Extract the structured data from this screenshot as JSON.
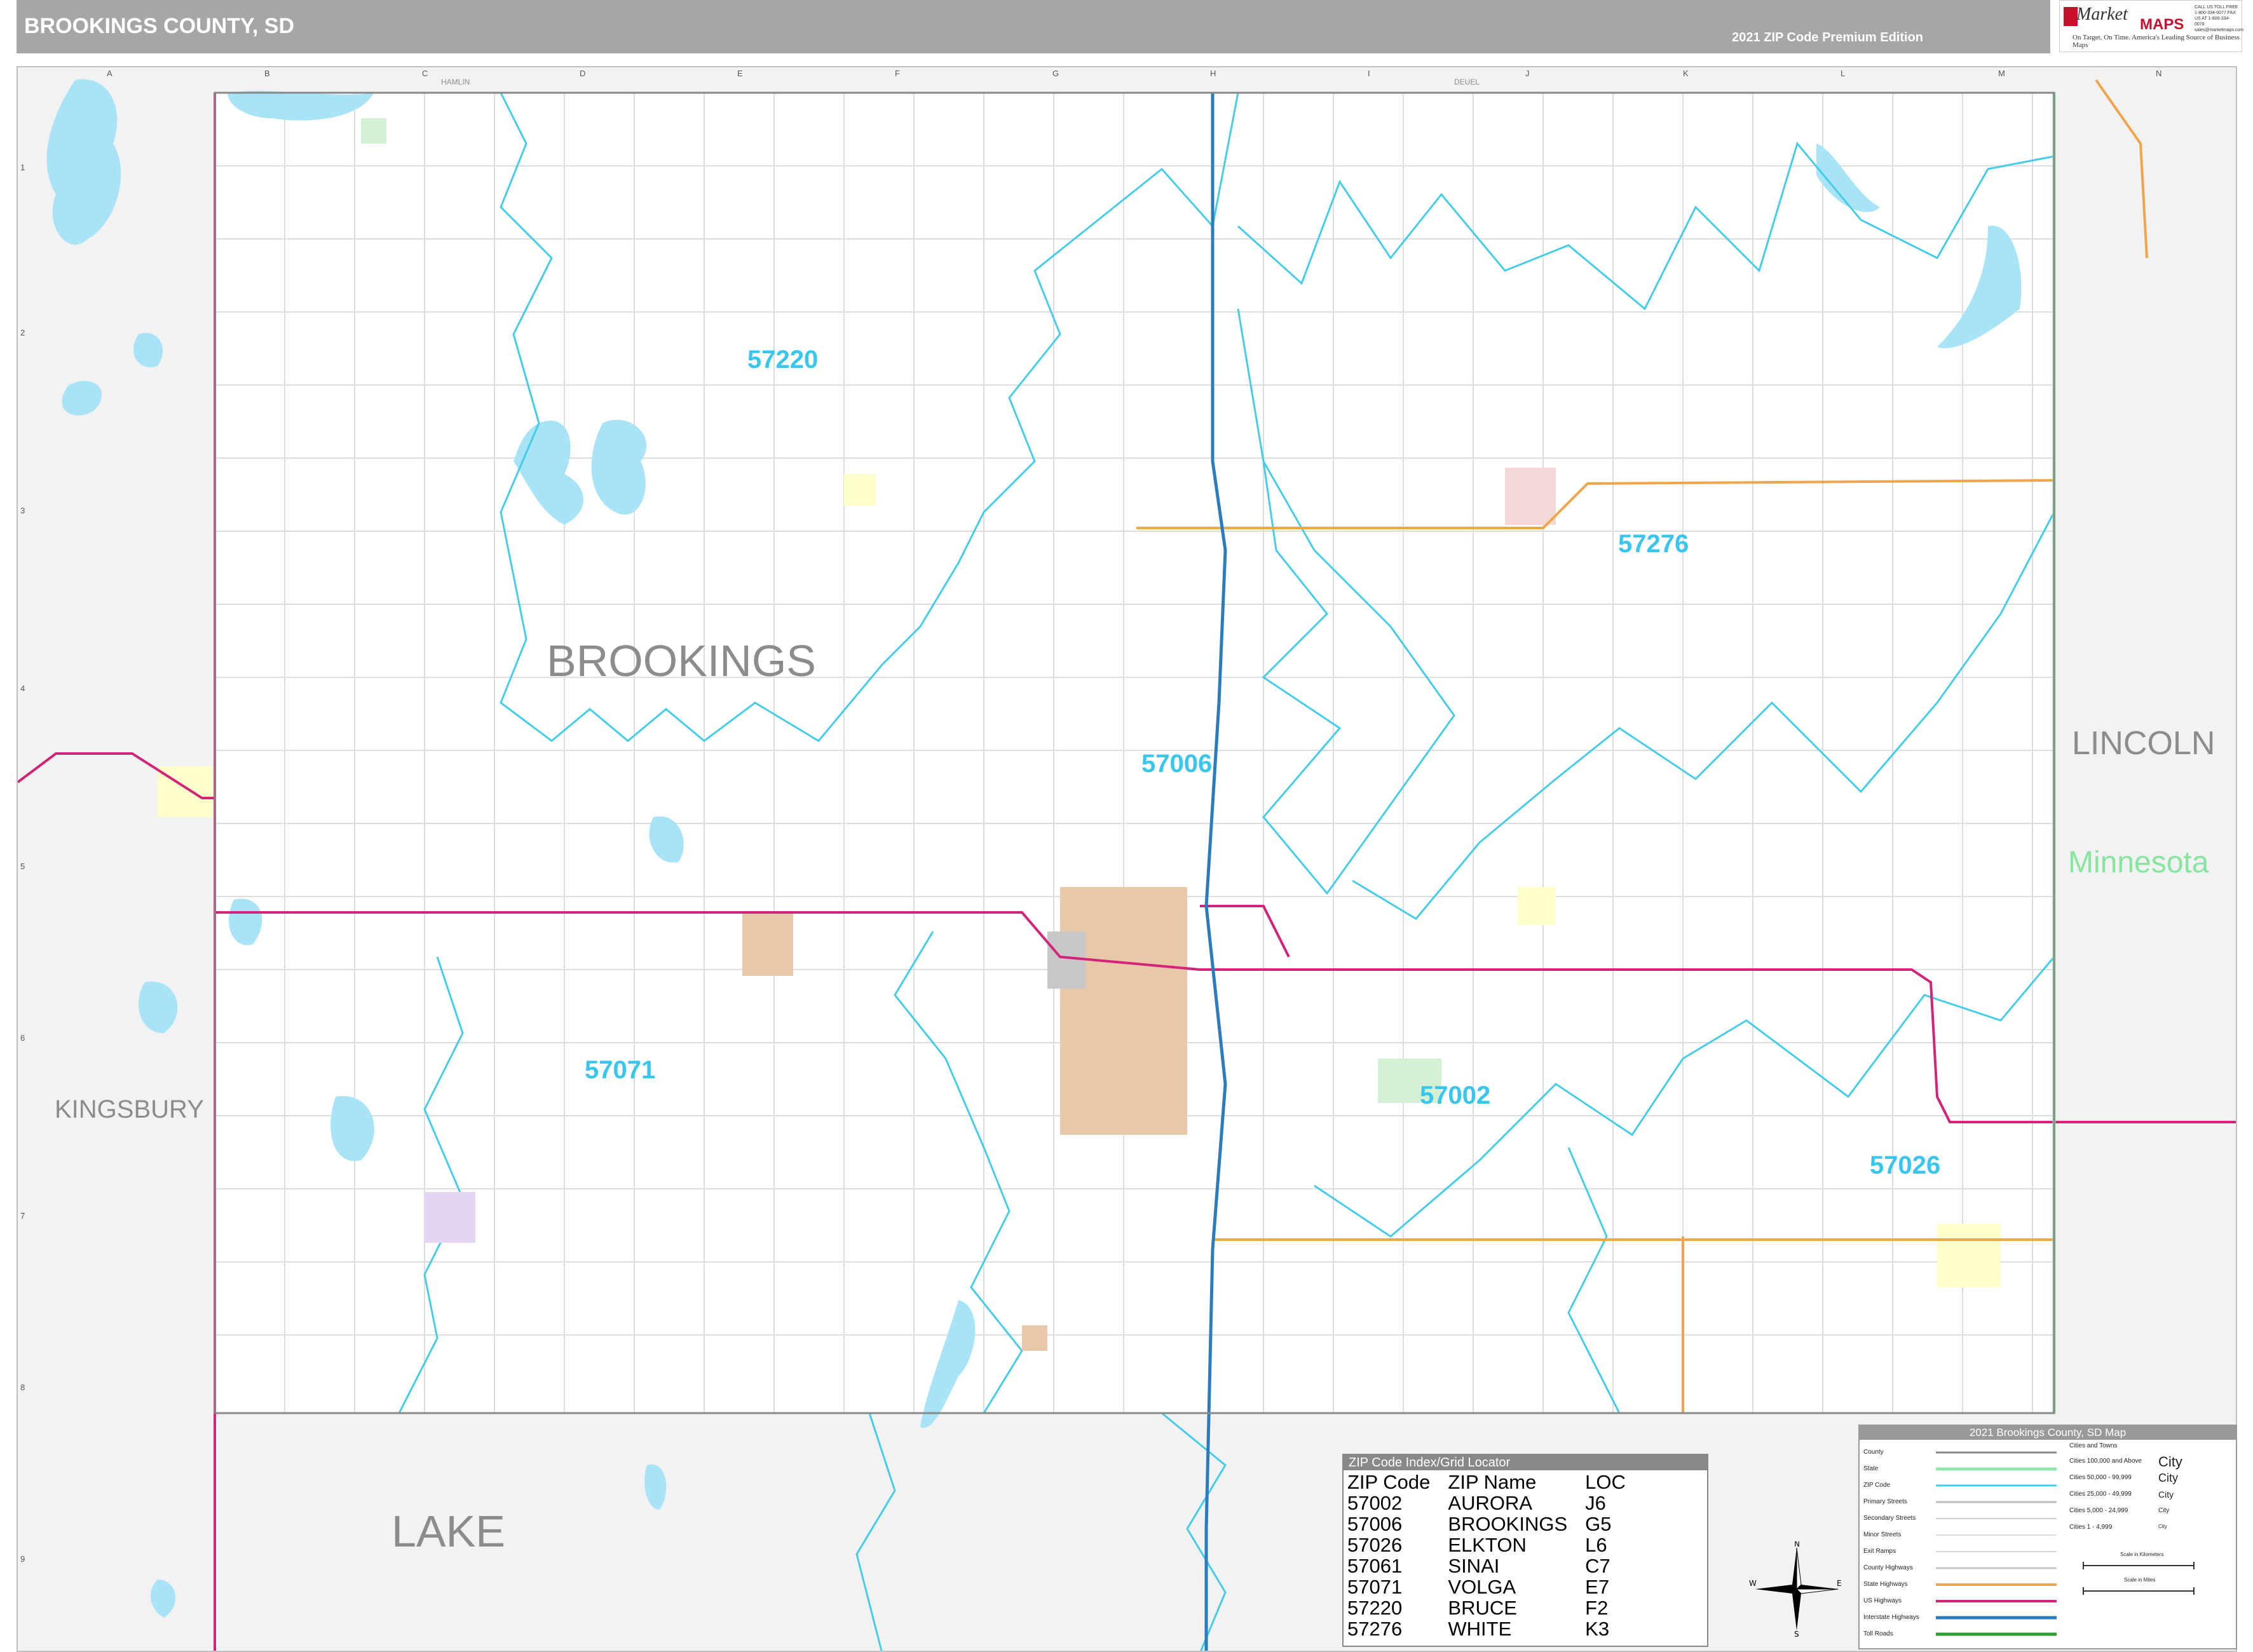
{
  "header": {
    "title": "BROOKINGS COUNTY, SD",
    "edition": "2021 ZIP Code Premium Edition"
  },
  "logo": {
    "brand_top": "Market",
    "brand_bottom": "MAPS",
    "tagline": "On Target, On Time. America's Leading Source of Business Maps",
    "contact": "CALL US TOLL FREE 1-800-334-0077 FAX US AT 1-800-334-0078 sales@marketmaps.com"
  },
  "map": {
    "counties": {
      "brookings": "BROOKINGS",
      "kingsbury": "KINGSBURY",
      "lake": "LAKE",
      "lincoln": "LINCOLN",
      "hamlin": "HAMLIN",
      "deuel": "DEUEL"
    },
    "state": "Minnesota",
    "zip_labels": {
      "z57220": "57220",
      "z57276": "57276",
      "z57006": "57006",
      "z57071": "57071",
      "z57002": "57002",
      "z57026": "57026"
    },
    "grid_columns": [
      "A",
      "B",
      "C",
      "D",
      "E",
      "F",
      "G",
      "H",
      "I",
      "J",
      "K",
      "L",
      "M",
      "N"
    ],
    "grid_rows": [
      "1",
      "2",
      "3",
      "4",
      "5",
      "6",
      "7",
      "8",
      "9"
    ]
  },
  "zip_index": {
    "title": "ZIP Code Index/Grid Locator",
    "headers": [
      "ZIP Code",
      "ZIP Name",
      "LOC"
    ],
    "rows": [
      [
        "57002",
        "AURORA",
        "J6"
      ],
      [
        "57006",
        "BROOKINGS",
        "G5"
      ],
      [
        "57026",
        "ELKTON",
        "L6"
      ],
      [
        "57061",
        "SINAI",
        "C7"
      ],
      [
        "57071",
        "VOLGA",
        "E7"
      ],
      [
        "57220",
        "BRUCE",
        "F2"
      ],
      [
        "57276",
        "WHITE",
        "K3"
      ]
    ]
  },
  "legend": {
    "title": "2021 Brookings County, SD Map",
    "left_items": [
      "County",
      "State",
      "ZIP Code",
      "Primary Streets",
      "Secondary Streets",
      "Minor Streets",
      "Exit Ramps",
      "County Highways",
      "State Highways",
      "US Highways",
      "Interstate Highways",
      "Toll Roads"
    ],
    "cities_header": "Cities and Towns",
    "city_classes": [
      {
        "range": "Cities 100,000 and Above",
        "sample": "City"
      },
      {
        "range": "Cities 50,000 - 99,999",
        "sample": "City"
      },
      {
        "range": "Cities 25,000 - 49,999",
        "sample": "City"
      },
      {
        "range": "Cities 5,000 - 24,999",
        "sample": "City"
      },
      {
        "range": "Cities 1 - 4,999",
        "sample": "City"
      }
    ],
    "scale_km": "Scale in Kilometers",
    "scale_mi": "Scale in Miles"
  },
  "compass": {
    "n": "N",
    "s": "S",
    "e": "E",
    "w": "W"
  },
  "colors": {
    "water": "#a8e3f7",
    "zip_boundary": "#45cce9",
    "us_highway": "#d4237a",
    "interstate": "#2b7bbf",
    "state_highway": "#f0a54a",
    "state_line": "#8ce8a8",
    "outside_county": "#f2f2f2"
  }
}
